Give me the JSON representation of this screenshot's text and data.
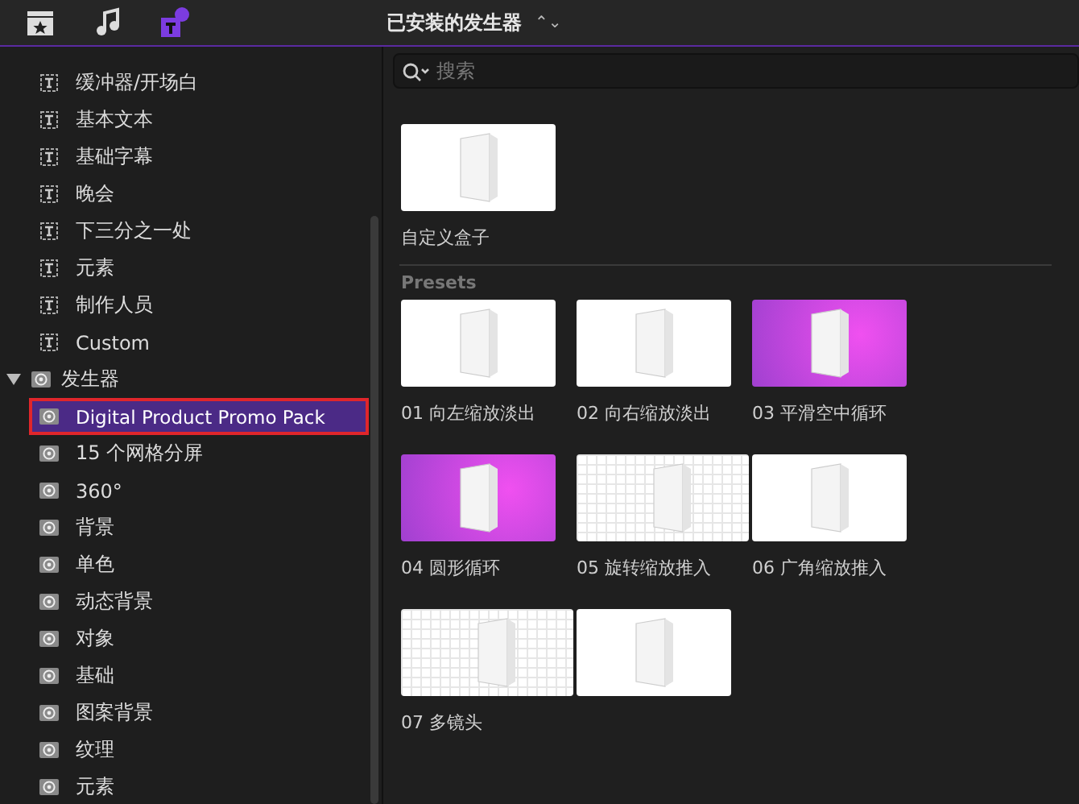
{
  "toolbar": {
    "tabs": [
      {
        "kind": "media",
        "selected": false
      },
      {
        "kind": "audio",
        "selected": false
      },
      {
        "kind": "titles",
        "selected": true
      }
    ]
  },
  "sidebar": {
    "items": [
      {
        "kind": "title",
        "label": "缓冲器/开场白",
        "selected": false
      },
      {
        "kind": "title",
        "label": "基本文本",
        "selected": false
      },
      {
        "kind": "title",
        "label": "基础字幕",
        "selected": false
      },
      {
        "kind": "title",
        "label": "晚会",
        "selected": false
      },
      {
        "kind": "title",
        "label": "下三分之一处",
        "selected": false
      },
      {
        "kind": "title",
        "label": "元素",
        "selected": false
      },
      {
        "kind": "title",
        "label": "制作人员",
        "selected": false
      },
      {
        "kind": "title",
        "label": "Custom",
        "selected": false
      },
      {
        "kind": "generator",
        "label": "发生器",
        "selected": false,
        "expanded": true,
        "children": [
          {
            "kind": "generator",
            "label": "Digital Product Promo Pack",
            "selected": true
          },
          {
            "kind": "generator",
            "label": "15 个网格分屏",
            "selected": false
          },
          {
            "kind": "generator",
            "label": "360°",
            "selected": false
          },
          {
            "kind": "generator",
            "label": "背景",
            "selected": false
          },
          {
            "kind": "generator",
            "label": "单色",
            "selected": false
          },
          {
            "kind": "generator",
            "label": "动态背景",
            "selected": false
          },
          {
            "kind": "generator",
            "label": "对象",
            "selected": false
          },
          {
            "kind": "generator",
            "label": "基础",
            "selected": false
          },
          {
            "kind": "generator",
            "label": "图案背景",
            "selected": false
          },
          {
            "kind": "generator",
            "label": "纹理",
            "selected": false
          },
          {
            "kind": "generator",
            "label": "元素",
            "selected": false
          }
        ]
      }
    ]
  },
  "browser": {
    "title": "已安装的发生器",
    "title_chevron": "⌃⌄",
    "search": {
      "placeholder": "搜索"
    },
    "items": [
      {
        "label": "自定义盒子",
        "kind": "plain"
      }
    ],
    "sections": [
      {
        "heading": "Presets",
        "items": [
          {
            "label": "01 向左缩放淡出",
            "kind": "plain"
          },
          {
            "label": "02 向右缩放淡出",
            "kind": "plain"
          },
          {
            "label": "03 平滑空中循环",
            "kind": "magenta"
          },
          {
            "label": "04 圆形循环",
            "kind": "magenta"
          },
          {
            "label": "05 旋转缩放推入",
            "kind": "grid"
          },
          {
            "label": "06 广角缩放推入",
            "kind": "plain"
          },
          {
            "label": "07 多镜头",
            "kind": "grid"
          },
          {
            "kind": "plain"
          }
        ]
      }
    ]
  }
}
